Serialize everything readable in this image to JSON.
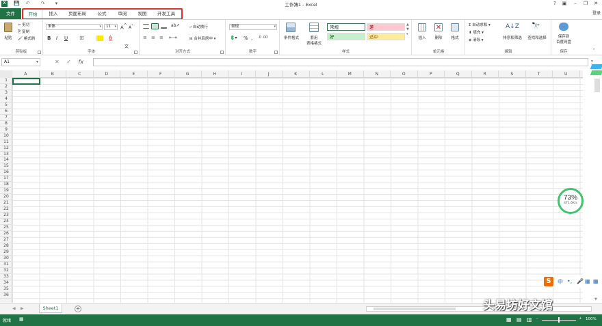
{
  "title": "工作簿1 - Excel",
  "login": "登录",
  "quick_access": [
    "💾",
    "↶",
    "↷",
    "▾"
  ],
  "tabs": {
    "file": "文件",
    "items": [
      "开始",
      "插入",
      "页面布局",
      "公式",
      "审阅",
      "视图",
      "开发工具"
    ]
  },
  "ribbon": {
    "clipboard": {
      "label": "剪贴板",
      "paste": "粘贴",
      "cut": "剪切",
      "copy": "复制",
      "painter": "格式刷"
    },
    "font": {
      "label": "字体",
      "name": "宋体",
      "size": "11",
      "bold": "B",
      "italic": "I",
      "underline": "U"
    },
    "alignment": {
      "label": "对齐方式",
      "wrap": "自动换行",
      "merge": "合并后居中"
    },
    "number": {
      "label": "数字",
      "format": "常规",
      "percent": "%",
      "comma": ","
    },
    "styles": {
      "label": "样式",
      "cond": "条件格式",
      "table_l1": "套用",
      "table_l2": "表格格式",
      "cells": [
        {
          "text": "常规",
          "bg": "#ffffff",
          "color": "#222"
        },
        {
          "text": "差",
          "bg": "#ffc7ce",
          "color": "#9c0006"
        },
        {
          "text": "好",
          "bg": "#c6efce",
          "color": "#006100"
        },
        {
          "text": "适中",
          "bg": "#ffeb9c",
          "color": "#9c5700"
        }
      ]
    },
    "cells": {
      "label": "单元格",
      "insert": "插入",
      "delete": "删除",
      "format": "格式"
    },
    "editing": {
      "label": "编辑",
      "autosum": "自动求和",
      "fill": "填充",
      "clear": "清除",
      "sort": "排序和筛选",
      "find": "查找和选择"
    },
    "save": {
      "label": "保存",
      "btn_l1": "保存到",
      "btn_l2": "百度网盘"
    }
  },
  "namebox": "A1",
  "fx": "fx",
  "columns": [
    "A",
    "B",
    "C",
    "D",
    "E",
    "F",
    "G",
    "H",
    "I",
    "J",
    "K",
    "L",
    "M",
    "N",
    "O",
    "P",
    "Q",
    "R",
    "S",
    "T",
    "U"
  ],
  "rows": [
    "1",
    "2",
    "3",
    "4",
    "5",
    "6",
    "7",
    "8",
    "9",
    "10",
    "11",
    "12",
    "13",
    "14",
    "15",
    "16",
    "17",
    "18",
    "19",
    "20",
    "21",
    "22",
    "23",
    "24",
    "25",
    "26",
    "27",
    "28",
    "29",
    "30",
    "31",
    "32",
    "33",
    "34",
    "35",
    "36"
  ],
  "sheet": "Sheet1",
  "status": "就绪",
  "zoom": "100%",
  "gauge": {
    "percent": "73%",
    "speed": "471.6K/s"
  },
  "ime": {
    "logo": "S",
    "lang": "中"
  },
  "watermark": "头易坊好文馆"
}
